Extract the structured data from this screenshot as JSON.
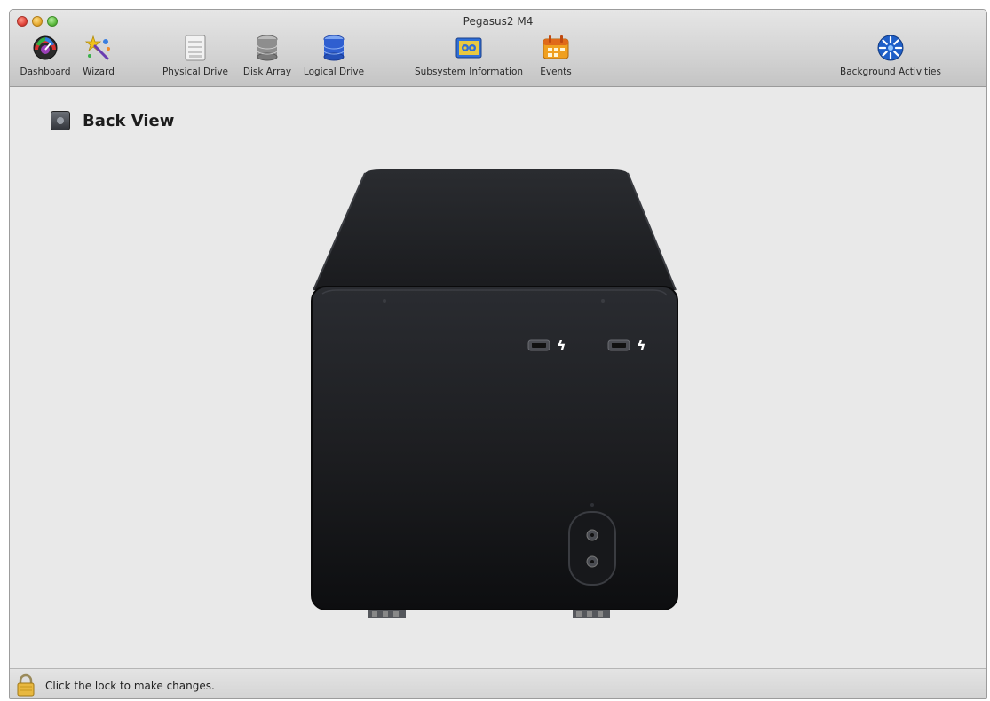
{
  "window": {
    "title": "Pegasus2 M4"
  },
  "toolbar": {
    "items": [
      {
        "label": "Dashboard",
        "icon": "dashboard-gauge-icon"
      },
      {
        "label": "Wizard",
        "icon": "wizard-icon"
      },
      {
        "label": "Physical Drive",
        "icon": "physical-drive-icon"
      },
      {
        "label": "Disk Array",
        "icon": "disk-array-icon"
      },
      {
        "label": "Logical Drive",
        "icon": "logical-drive-icon"
      },
      {
        "label": "Subsystem Information",
        "icon": "subsystem-information-icon"
      },
      {
        "label": "Events",
        "icon": "events-calendar-icon"
      },
      {
        "label": "Background Activities",
        "icon": "background-activities-icon"
      }
    ]
  },
  "content": {
    "section_title": "Back View"
  },
  "status": {
    "lock_text": "Click the lock to make changes."
  },
  "colors": {
    "device_body": "#1f2023",
    "window_bg": "#e9e9e9",
    "logical_drive_blue": "#2f5fd0",
    "events_orange": "#f0a020"
  }
}
